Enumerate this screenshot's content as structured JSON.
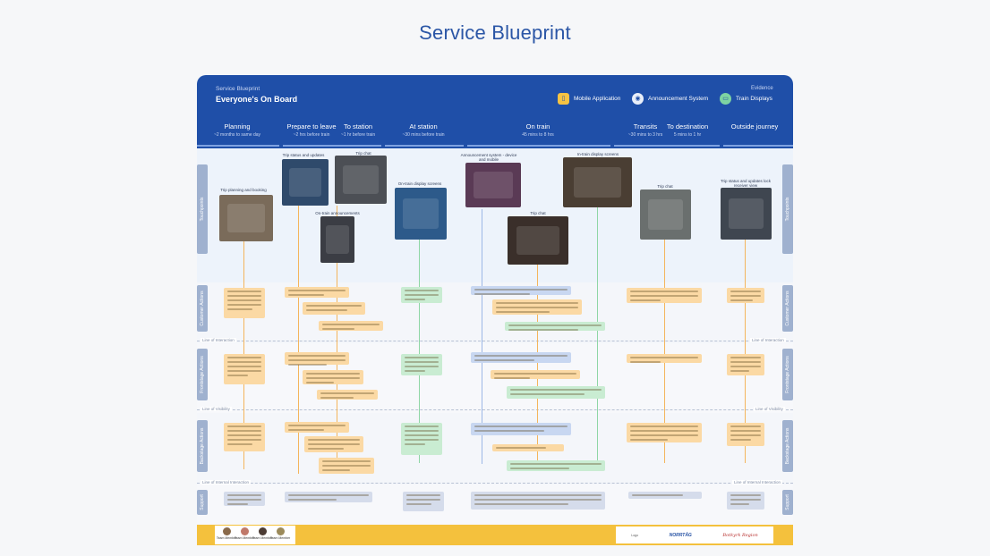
{
  "page_title": "Service Blueprint",
  "header": {
    "subtitle": "Service Blueprint",
    "title": "Everyone's On Board",
    "evidence_label": "Evidence",
    "evidence": [
      {
        "label": "Mobile Application",
        "icon": "mobile-app-icon"
      },
      {
        "label": "Announcement System",
        "icon": "announcement-icon"
      },
      {
        "label": "Train Displays",
        "icon": "train-display-icon"
      }
    ]
  },
  "phases": [
    {
      "name": "Planning",
      "time": "~2 months to same day"
    },
    {
      "name": "Prepare to leave",
      "time": "~2 hrs before train"
    },
    {
      "name": "To station",
      "time": "~1 hr before train"
    },
    {
      "name": "At station",
      "time": "~30 mins before train"
    },
    {
      "name": "On train",
      "time": "45 mins to 8 hrs"
    },
    {
      "name": "Transits",
      "time": "~30 mins to 3 hrs"
    },
    {
      "name": "To destination",
      "time": "5 mins to 1 hr"
    },
    {
      "name": "Outside journey",
      "time": ""
    }
  ],
  "lanes": [
    "Touchpoints",
    "Customer Actions",
    "Frontstage Actions",
    "Backstage Actions",
    "Support"
  ],
  "dividers": [
    "Line of Interaction",
    "Line of Visibility",
    "Line of Internal Interaction"
  ],
  "touchpoints": [
    "Trip planning and booking",
    "Trip status and updates",
    "Trip chat",
    "On-train announcements",
    "On-train display screens",
    "Announcement system - device and mobile",
    "Trip chat",
    "In-train display screens",
    "Trip chat",
    "Trip status and updates lock receiver view"
  ],
  "footer": {
    "people": [
      "Team Member",
      "Team Member",
      "Team Member",
      "Team Member"
    ],
    "logos": [
      "Logo",
      "NORRTÅG",
      "Botkyrk Region"
    ]
  },
  "colors": {
    "header": "#1f4fa8",
    "footer": "#f4c13d",
    "orange_note": "#fbd9a4",
    "green_note": "#c9ecd2",
    "blue_note": "#c8d7f1"
  }
}
